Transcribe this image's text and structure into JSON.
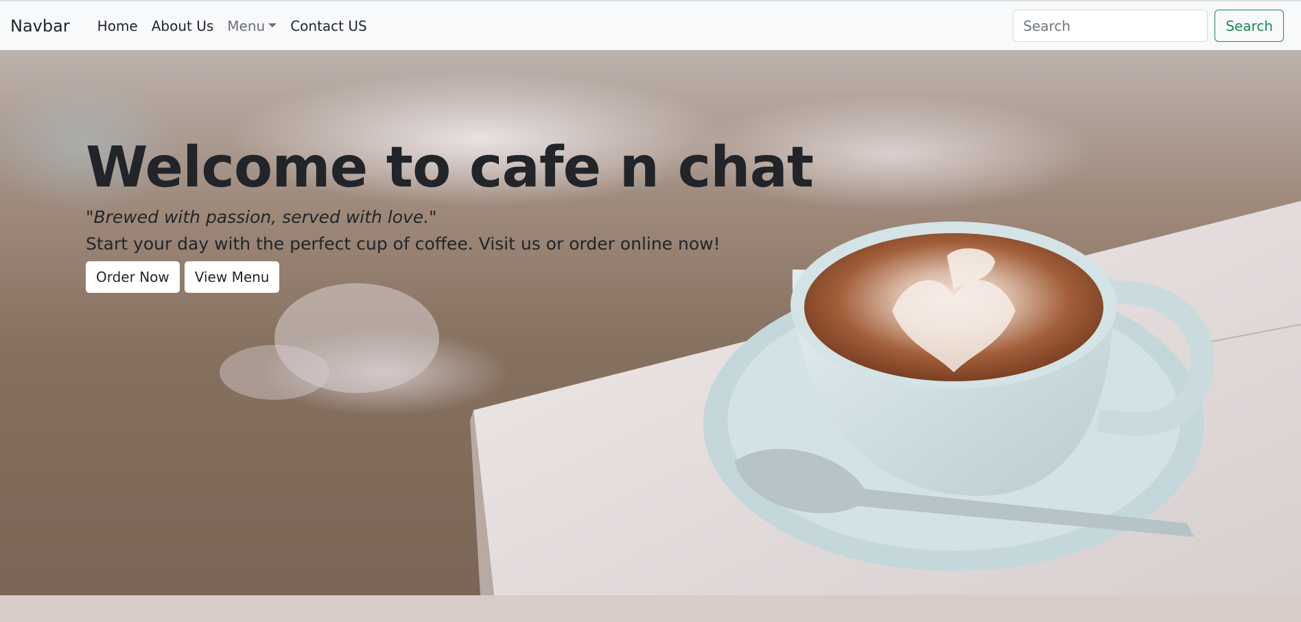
{
  "navbar": {
    "brand": "Navbar",
    "links": [
      "Home",
      "About Us",
      "Menu",
      "Contact US"
    ],
    "search": {
      "placeholder": "Search",
      "button_label": "Search"
    }
  },
  "hero": {
    "title": "Welcome to cafe n chat",
    "tagline": "\"Brewed with passion, served with love.\"",
    "subtitle": "Start your day with the perfect cup of coffee. Visit us or order online now!",
    "buttons": {
      "order": "Order Now",
      "menu": "View Menu"
    }
  },
  "colors": {
    "navbar_bg": "#f8f9fa",
    "search_button": "#198754",
    "footer_band": "#d9ccc8"
  },
  "icons": {
    "menu_dropdown": "caret-down-icon"
  }
}
